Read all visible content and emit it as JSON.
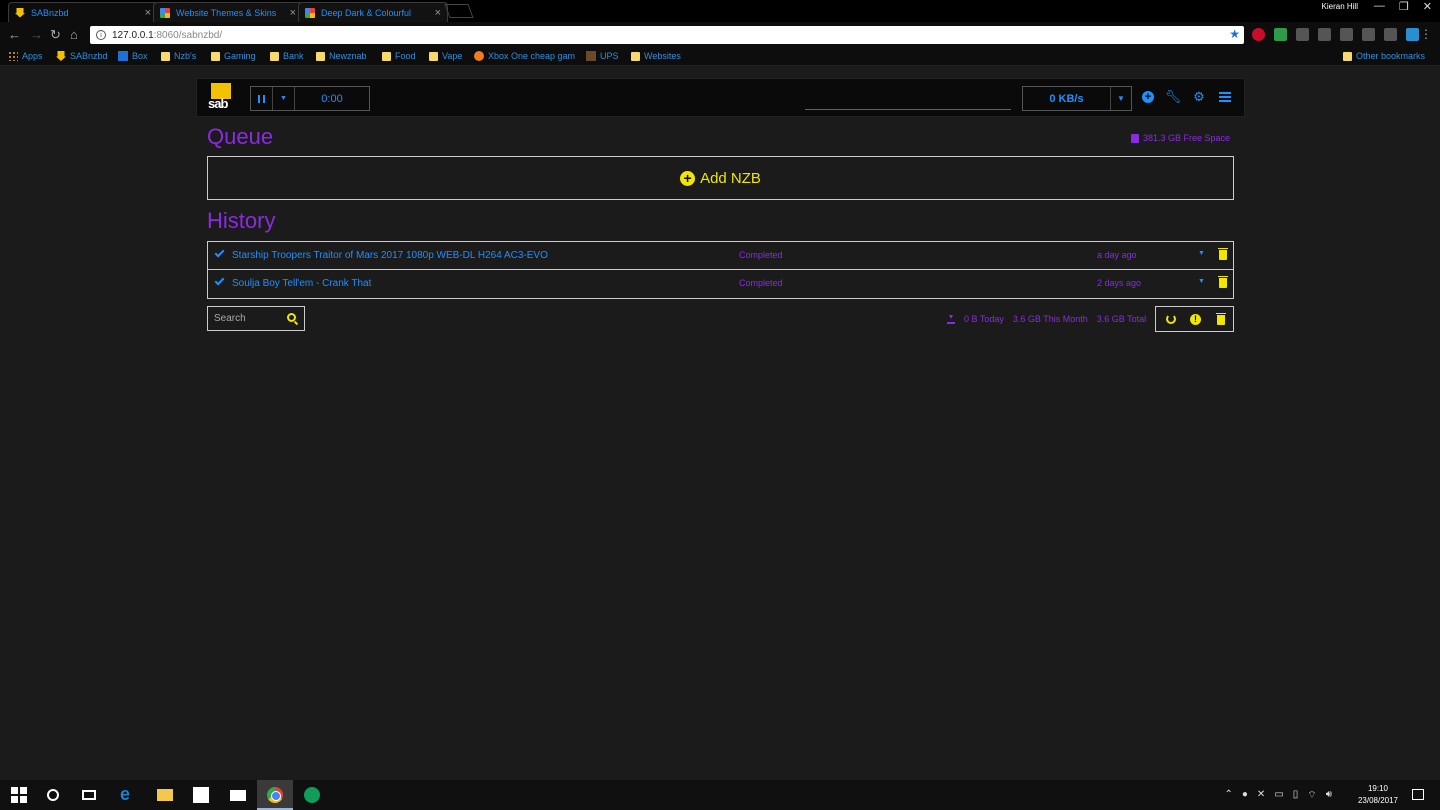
{
  "browser": {
    "tabs": [
      {
        "title": "SABnzbd",
        "active": true
      },
      {
        "title": "Website Themes & Skins",
        "active": false
      },
      {
        "title": "Deep Dark & Colourful",
        "active": false
      }
    ],
    "user": "Kieran Hill",
    "url_host": "127.0.0.1",
    "url_path": ":8060/sabnzbd/",
    "bookmarks": [
      "Apps",
      "SABnzbd",
      "Box",
      "Nzb's",
      "Gaming",
      "Bank",
      "Newznab",
      "Food",
      "Vape",
      "Xbox One cheap gam",
      "UPS",
      "Websites"
    ],
    "other_bookmarks": "Other bookmarks"
  },
  "sab": {
    "logo_text": "sab",
    "timer": "0:00",
    "speed": "0 KB/s",
    "queue_title": "Queue",
    "free_space": "381.3 GB Free Space",
    "add_nzb": "Add NZB",
    "history_title": "History",
    "history": [
      {
        "name": "Starship Troopers Traitor of Mars 2017 1080p WEB-DL H264 AC3-EVO",
        "status": "Completed",
        "time": "a day ago"
      },
      {
        "name": "Soulja Boy Tell'em - Crank That",
        "status": "Completed",
        "time": "2 days ago"
      }
    ],
    "search_placeholder": "Search",
    "stats": {
      "today": "0 B Today",
      "month": "3.6 GB This Month",
      "total": "3.6 GB Total"
    }
  },
  "taskbar": {
    "time": "19:10",
    "date": "23/08/2017"
  },
  "colors": {
    "accent_blue": "#1e90ff",
    "accent_purple": "#8a2be2",
    "accent_yellow": "#f2e600",
    "background": "#1b1b1b"
  }
}
